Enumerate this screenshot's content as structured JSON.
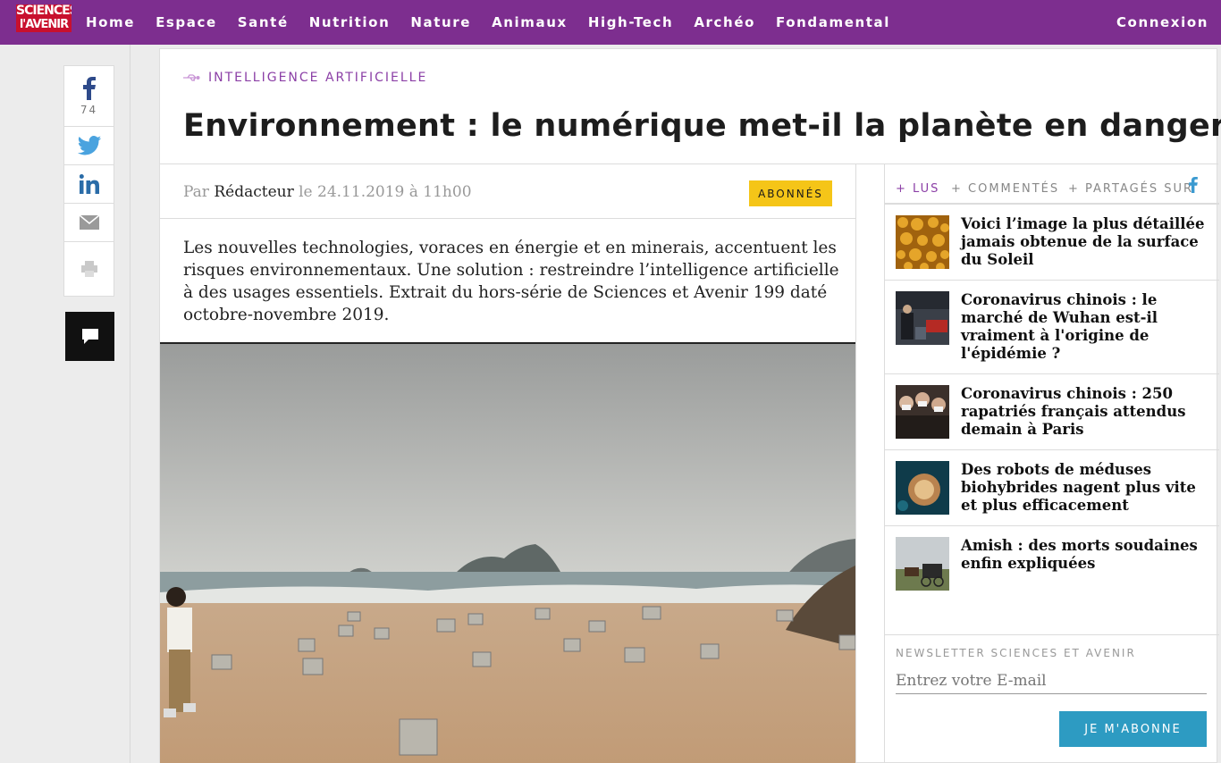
{
  "nav": {
    "logo_line1": "SCIENCES",
    "logo_line2": "l'AVENIR",
    "links": [
      "Home",
      "Espace",
      "Santé",
      "Nutrition",
      "Nature",
      "Animaux",
      "High-Tech",
      "Archéo",
      "Fondamental"
    ],
    "login": "Connexion"
  },
  "share": {
    "facebook_count": "74"
  },
  "article": {
    "category": "INTELLIGENCE ARTIFICIELLE",
    "headline": "Environnement : le numérique met-il la planète en danger ?",
    "byline_prefix": "Par",
    "author": "Rédacteur",
    "date": "le 24.11.2019 à 11h00",
    "badge": "ABONNÉS",
    "lede": "Les nouvelles technologies, voraces en énergie et en minerais, accentuent les risques environnementaux. Une solution : restreindre l’intelligence artificielle à des usages essentiels. Extrait du hors-série de Sciences et Avenir 199 daté octobre-novembre 2019."
  },
  "sidebar": {
    "tabs": [
      "+ LUS",
      "+ COMMENTÉS",
      "+ PARTAGÉS SUR"
    ],
    "articles": [
      {
        "title": "Voici l’image la plus détaillée jamais obtenue de la surface du Soleil"
      },
      {
        "title": "Coronavirus chinois : le marché de Wuhan est-il vraiment à l'origine de l'épidémie ?"
      },
      {
        "title": "Coronavirus chinois : 250 rapatriés français attendus demain à Paris"
      },
      {
        "title": "Des robots de méduses biohybrides nagent plus vite et plus efficacement"
      },
      {
        "title": "Amish : des morts soudaines enfin expliquées"
      }
    ],
    "newsletter": {
      "label": "NEWSLETTER SCIENCES ET AVENIR",
      "placeholder": "Entrez votre E-mail",
      "button": "JE M'ABONNE"
    }
  },
  "colors": {
    "brand_purple": "#7d2e8f",
    "accent_purple": "#8b3fa6",
    "badge_yellow": "#f5c518",
    "button_blue": "#2d9bc2",
    "logo_red": "#c8102e"
  }
}
